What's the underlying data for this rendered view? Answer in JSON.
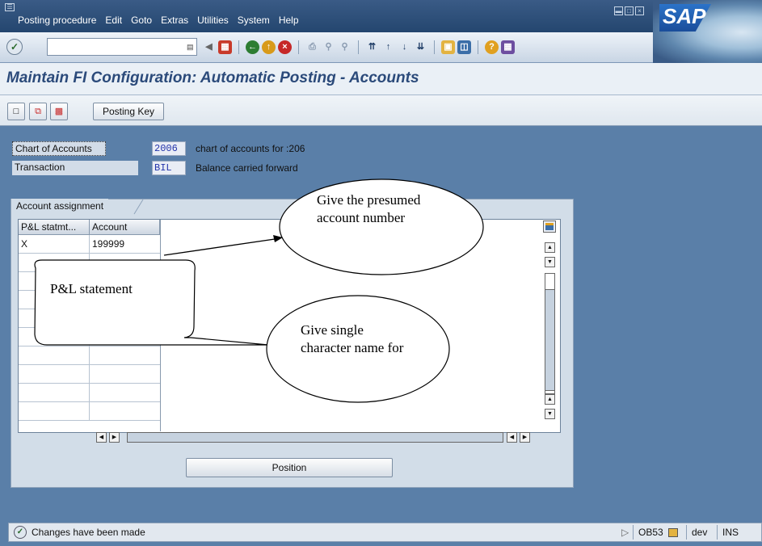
{
  "menubar": {
    "items": [
      "Posting procedure",
      "Edit",
      "Goto",
      "Extras",
      "Utilities",
      "System",
      "Help"
    ]
  },
  "window_buttons": [
    "minimize-icon",
    "maximize-icon",
    "close-icon"
  ],
  "logo_text": "SAP",
  "toolbar": {
    "command_field_value": "",
    "icons": [
      "enter-icon",
      "save-icon",
      "back-icon",
      "exit-icon",
      "cancel-icon",
      "print-icon",
      "find-icon",
      "find-next-icon",
      "first-page-icon",
      "previous-page-icon",
      "next-page-icon",
      "last-page-icon",
      "new-session-icon",
      "shortcut-icon",
      "help-icon",
      "layout-icon"
    ]
  },
  "title": "Maintain FI Configuration: Automatic Posting - Accounts",
  "app_toolbar": {
    "posting_key_label": "Posting Key",
    "icons": [
      "new-entry-icon",
      "copy-icon",
      "save-layout-icon"
    ]
  },
  "header": {
    "chart_of_accounts_label": "Chart of Accounts",
    "chart_of_accounts_value": "2006",
    "chart_of_accounts_desc": "chart of accounts for :206",
    "transaction_label": "Transaction",
    "transaction_value": "BIL",
    "transaction_desc": "Balance carried forward"
  },
  "account_assignment": {
    "tab_label": "Account assignment",
    "columns": [
      "P&L statmt...",
      "Account"
    ],
    "rows": [
      [
        "X",
        "199999"
      ],
      [
        "",
        ""
      ],
      [
        "",
        ""
      ],
      [
        "",
        ""
      ],
      [
        "",
        ""
      ],
      [
        "",
        ""
      ],
      [
        "",
        ""
      ],
      [
        "",
        ""
      ],
      [
        "",
        ""
      ],
      [
        "",
        ""
      ]
    ],
    "position_button": "Position"
  },
  "callouts": {
    "account": "Give the presumed account number",
    "pl_statement": "P&L statement",
    "single_char": "Give single character name for"
  },
  "statusbar": {
    "message": "Changes have been made",
    "transaction_code": "OB53",
    "system": "dev",
    "mode": "INS"
  },
  "colors": {
    "background": "#5a7fa8",
    "title_text": "#2b4a7a",
    "menubar": "#2d4e79"
  }
}
